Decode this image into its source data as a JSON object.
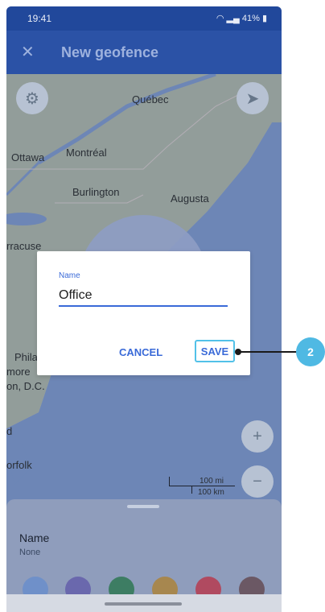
{
  "status_bar": {
    "time": "19:41",
    "battery": "41%"
  },
  "app_bar": {
    "title": "New geofence",
    "close_icon": "close-icon"
  },
  "map": {
    "labels": [
      "Québec",
      "Ottawa",
      "Montréal",
      "Burlington",
      "Augusta",
      "rracuse",
      "Phila",
      "more",
      "on, D.C.",
      "d",
      "orfolk"
    ],
    "scale_mi": "100 mi",
    "scale_km": "100 km",
    "controls": {
      "settings_icon": "gear-icon",
      "location_icon": "navigation-arrow-icon",
      "zoom_in": "+",
      "zoom_out": "−"
    }
  },
  "dialog": {
    "field_label": "Name",
    "field_value": "Office",
    "cancel_label": "CANCEL",
    "save_label": "SAVE"
  },
  "callout": {
    "number": "2"
  },
  "bottom_sheet": {
    "name_label": "Name",
    "name_value": "None",
    "colors": [
      "#6f90c9",
      "#6a68ad",
      "#3d7d63",
      "#a7874f",
      "#b04a60",
      "#6b5864"
    ]
  },
  "colors": {
    "accent": "#3a6ad8",
    "app_bar": "#2b52a6",
    "highlight": "#52c1e8",
    "callout": "#4fb9e3"
  }
}
